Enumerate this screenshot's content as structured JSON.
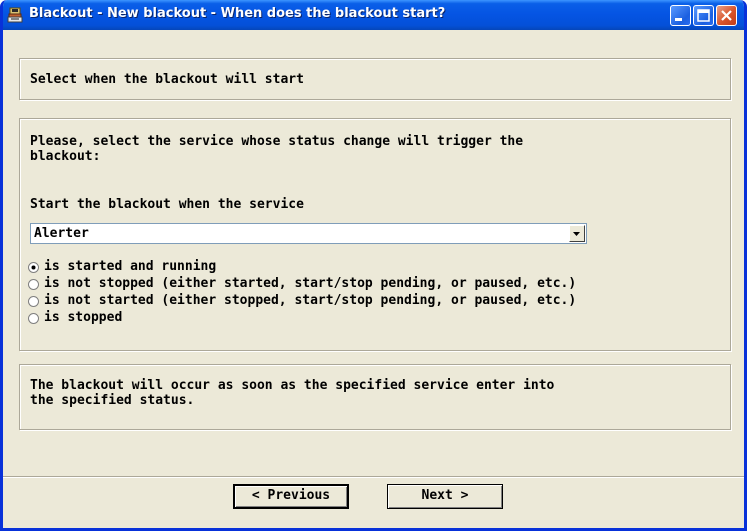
{
  "window": {
    "title": "Blackout - New blackout - When does the blackout start?",
    "icon": "blackout-app-icon",
    "controls": [
      "minimize-icon",
      "maximize-icon",
      "close-icon"
    ]
  },
  "header": {
    "text": "Select when the blackout will start"
  },
  "service_section": {
    "instruction_line1": "Please, select the service whose status change will trigger the",
    "instruction_line2": "blackout:",
    "start_label": "Start the blackout when the service",
    "service_select": {
      "selected": "Alerter"
    },
    "options": [
      {
        "label": "is started and running",
        "checked": true
      },
      {
        "label": "is not stopped (either started, start/stop pending, or paused, etc.)",
        "checked": false
      },
      {
        "label": "is not started (either stopped, start/stop pending, or paused, etc.)",
        "checked": false
      },
      {
        "label": "is stopped",
        "checked": false
      }
    ]
  },
  "info": {
    "line1": "The blackout will occur as soon as the specified service enter into",
    "line2": "the specified status."
  },
  "buttons": {
    "previous": "< Previous",
    "next": "Next >"
  }
}
